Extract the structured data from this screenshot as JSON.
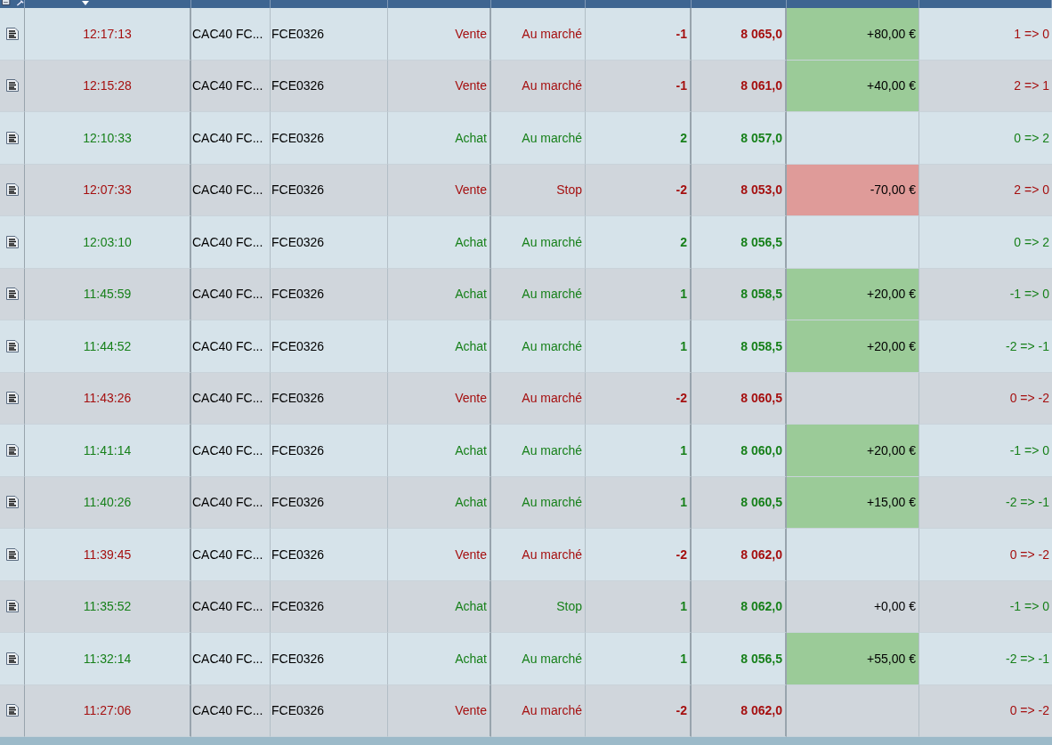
{
  "table": {
    "rows": [
      {
        "kind": "sell",
        "date": "12:17:13",
        "name": "CAC40 FC...",
        "symbol": "FCE0326",
        "direction": "Vente",
        "type": "Au marché",
        "qty": "-1",
        "price": "8 065,0",
        "gain": "+80,00 €",
        "profit": true,
        "loss": false,
        "change": "1 => 0"
      },
      {
        "kind": "sell",
        "date": "12:15:28",
        "name": "CAC40 FC...",
        "symbol": "FCE0326",
        "direction": "Vente",
        "type": "Au marché",
        "qty": "-1",
        "price": "8 061,0",
        "gain": "+40,00 €",
        "profit": true,
        "loss": false,
        "change": "2 => 1"
      },
      {
        "kind": "buy",
        "date": "12:10:33",
        "name": "CAC40 FC...",
        "symbol": "FCE0326",
        "direction": "Achat",
        "type": "Au marché",
        "qty": "2",
        "price": "8 057,0",
        "profit": false,
        "loss": false,
        "change": "0 => 2"
      },
      {
        "kind": "sell",
        "date": "12:07:33",
        "name": "CAC40 FC...",
        "symbol": "FCE0326",
        "direction": "Vente",
        "type": "Stop",
        "qty": "-2",
        "price": "8 053,0",
        "gain": "-70,00 €",
        "profit": false,
        "loss": true,
        "change": "2 => 0"
      },
      {
        "kind": "buy",
        "date": "12:03:10",
        "name": "CAC40 FC...",
        "symbol": "FCE0326",
        "direction": "Achat",
        "type": "Au marché",
        "qty": "2",
        "price": "8 056,5",
        "profit": false,
        "loss": false,
        "change": "0 => 2"
      },
      {
        "kind": "buy",
        "date": "11:45:59",
        "name": "CAC40 FC...",
        "symbol": "FCE0326",
        "direction": "Achat",
        "type": "Au marché",
        "qty": "1",
        "price": "8 058,5",
        "gain": "+20,00 €",
        "profit": true,
        "loss": false,
        "change": "-1 => 0"
      },
      {
        "kind": "buy",
        "date": "11:44:52",
        "name": "CAC40 FC...",
        "symbol": "FCE0326",
        "direction": "Achat",
        "type": "Au marché",
        "qty": "1",
        "price": "8 058,5",
        "gain": "+20,00 €",
        "profit": true,
        "loss": false,
        "change": "-2 => -1"
      },
      {
        "kind": "sell",
        "date": "11:43:26",
        "name": "CAC40 FC...",
        "symbol": "FCE0326",
        "direction": "Vente",
        "type": "Au marché",
        "qty": "-2",
        "price": "8 060,5",
        "profit": false,
        "loss": false,
        "change": "0 => -2"
      },
      {
        "kind": "buy",
        "date": "11:41:14",
        "name": "CAC40 FC...",
        "symbol": "FCE0326",
        "direction": "Achat",
        "type": "Au marché",
        "qty": "1",
        "price": "8 060,0",
        "gain": "+20,00 €",
        "profit": true,
        "loss": false,
        "change": "-1 => 0"
      },
      {
        "kind": "buy",
        "date": "11:40:26",
        "name": "CAC40 FC...",
        "symbol": "FCE0326",
        "direction": "Achat",
        "type": "Au marché",
        "qty": "1",
        "price": "8 060,5",
        "gain": "+15,00 €",
        "profit": true,
        "loss": false,
        "change": "-2 => -1"
      },
      {
        "kind": "sell",
        "date": "11:39:45",
        "name": "CAC40 FC...",
        "symbol": "FCE0326",
        "direction": "Vente",
        "type": "Au marché",
        "qty": "-2",
        "price": "8 062,0",
        "profit": false,
        "loss": false,
        "change": "0 => -2"
      },
      {
        "kind": "buy",
        "date": "11:35:52",
        "name": "CAC40 FC...",
        "symbol": "FCE0326",
        "direction": "Achat",
        "type": "Stop",
        "qty": "1",
        "price": "8 062,0",
        "gain": "+0,00 €",
        "profit": false,
        "loss": false,
        "change": "-1 => 0"
      },
      {
        "kind": "buy",
        "date": "11:32:14",
        "name": "CAC40 FC...",
        "symbol": "FCE0326",
        "direction": "Achat",
        "type": "Au marché",
        "qty": "1",
        "price": "8 056,5",
        "gain": "+55,00 €",
        "profit": true,
        "loss": false,
        "change": "-2 => -1"
      },
      {
        "kind": "sell",
        "date": "11:27:06",
        "name": "CAC40 FC...",
        "symbol": "FCE0326",
        "direction": "Vente",
        "type": "Au marché",
        "qty": "-2",
        "price": "8 062,0",
        "profit": false,
        "loss": false,
        "change": "0 => -2"
      }
    ]
  }
}
